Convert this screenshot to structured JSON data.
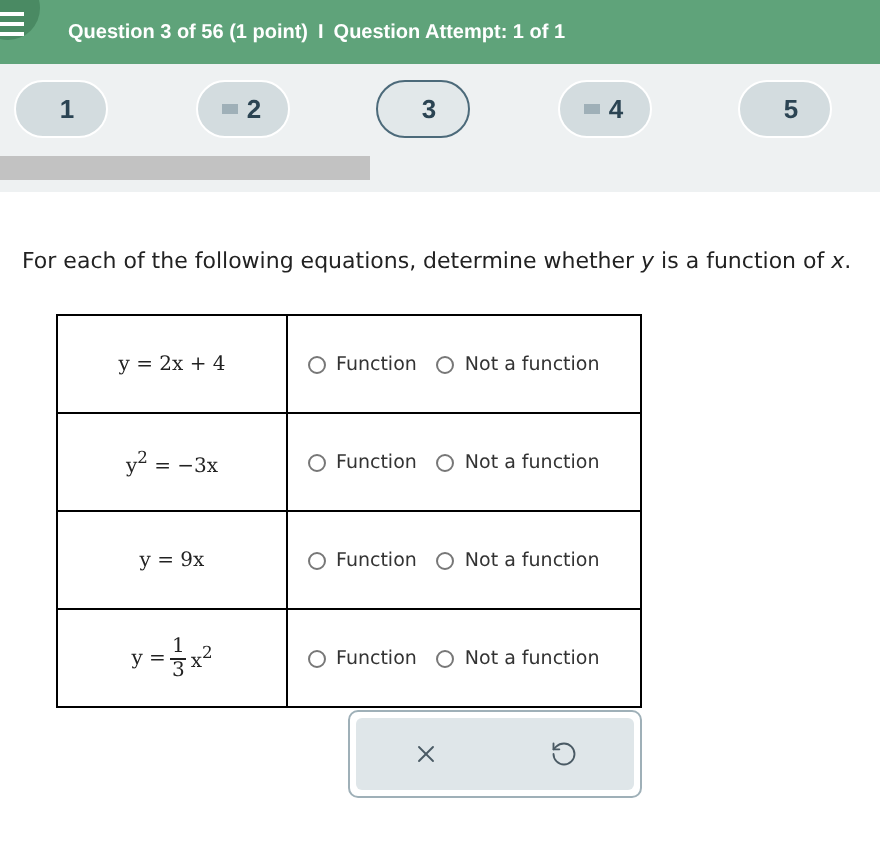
{
  "header": {
    "subtitle": "Question 3 of 56 (1 point)",
    "separator": "I",
    "attempt": "Question Attempt: 1 of 1"
  },
  "question_nav": [
    {
      "label": "1",
      "flagged": false,
      "selected": false
    },
    {
      "label": "2",
      "flagged": true,
      "selected": false
    },
    {
      "label": "3",
      "flagged": false,
      "selected": true
    },
    {
      "label": "4",
      "flagged": true,
      "selected": false
    },
    {
      "label": "5",
      "flagged": false,
      "selected": false
    }
  ],
  "progress": {
    "level": 0.42
  },
  "prompt": "For each of the following equations, determine whether *y* is a function of *x*.",
  "rows": [
    {
      "equation": {
        "kind": "plain",
        "text": "y = 2x + 4"
      },
      "options": [
        {
          "label": "Function",
          "selected": false
        },
        {
          "label": "Not a function",
          "selected": false
        }
      ]
    },
    {
      "equation": {
        "kind": "plain",
        "text": "y$^{2}$ = −3x"
      },
      "options": [
        {
          "label": "Function",
          "selected": false
        },
        {
          "label": "Not a function",
          "selected": false
        }
      ]
    },
    {
      "equation": {
        "kind": "plain",
        "text": "y = 9x"
      },
      "options": [
        {
          "label": "Function",
          "selected": false
        },
        {
          "label": "Not a function",
          "selected": false
        }
      ]
    },
    {
      "equation": {
        "kind": "fraction",
        "lead": "y =",
        "numerator": "1",
        "denominator": "3",
        "tail": "x$^{2}$"
      },
      "options": [
        {
          "label": "Function",
          "selected": false
        },
        {
          "label": "Not a function",
          "selected": false
        }
      ]
    }
  ],
  "actions": [
    {
      "kind": "clear"
    },
    {
      "kind": "undo"
    }
  ]
}
